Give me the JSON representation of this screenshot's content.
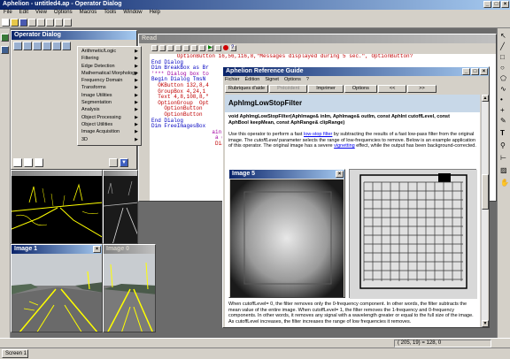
{
  "app": {
    "title": "Aphelion - untitled4.ap - Operator Dialog",
    "menu": [
      "File",
      "Edit",
      "View",
      "Options",
      "Macros",
      "Tools",
      "Window",
      "Help"
    ],
    "status_coords": "( 205,  19) = 128, 0",
    "taskbar_tab": "Screen 1"
  },
  "operator_dialog": {
    "title": "Operator Dialog",
    "categories": [
      "Arithmetic/Logic",
      "Filtering",
      "Edge Detection",
      "Mathematical Morphology",
      "Frequency Domain",
      "Transforms",
      "Image Utilities",
      "Segmentation",
      "Analysis",
      "Object Processing",
      "Object Utilities",
      "Image Acquisition",
      "3D"
    ]
  },
  "code_window": {
    "title": "Read",
    "lines": [
      {
        "t": "        OptionButton 16,56,116,8,\"Messages displayed during 5 sec.\", OptionButton?",
        "c": "c-red"
      },
      {
        "t": "End Dialog",
        "c": "c-blue"
      },
      {
        "t": "Dim BreakBox as Br",
        "c": "c-blue"
      },
      {
        "t": "",
        "c": "c-dark"
      },
      {
        "t": "'*** Dialog box to",
        "c": "c-mag"
      },
      {
        "t": "Begin Dialog TmsN",
        "c": "c-blue"
      },
      {
        "t": "  OKButton 132,8,4",
        "c": "c-red"
      },
      {
        "t": "  GroupBox 4,24,1",
        "c": "c-red"
      },
      {
        "t": "  Text 4,8,108,8,\"",
        "c": "c-red"
      },
      {
        "t": "  OptionGroup  Opt",
        "c": "c-red"
      },
      {
        "t": "    OptionButton",
        "c": "c-red"
      },
      {
        "t": "    OptionButton",
        "c": "c-red"
      },
      {
        "t": "End Dialog",
        "c": "c-blue"
      },
      {
        "t": "Dim FreeImagesBox",
        "c": "c-blue"
      },
      {
        "t": "",
        "c": "c-dark"
      },
      {
        "t": "                   ain pro",
        "c": "c-mag"
      },
      {
        "t": "",
        "c": "c-dark"
      },
      {
        "t": "                    a dial",
        "c": "c-mag"
      },
      {
        "t": "",
        "c": "c-dark"
      },
      {
        "t": "                    Dialo",
        "c": "c-red"
      }
    ]
  },
  "help": {
    "title": "Aphelion Reference Guide",
    "menu": [
      "Fichier",
      "Édition",
      "Signet",
      "Options",
      "?"
    ],
    "buttons": [
      "Rubriques d'aide",
      "Précédent",
      "Imprimer",
      "Options",
      "<<",
      ">>"
    ],
    "heading": "AphImgLowStopFilter",
    "signature_1": "void AphImgLowStopFilter(AphImage& inIm, AphImage& outIm, const AphInt cutoffLevel, const",
    "signature_2": "AphBool keepMean, const AphRange& clipRange)",
    "desc_1": "Use this operator to perform a fast ",
    "desc_link": "low-stop filter",
    "desc_2": " by subtracting the results of a fast low-pass filter from the original image. The ",
    "desc_italic": "cutoffLevel",
    "desc_3": " parameter selects the range of low-frequencies to remove. Below is an example application of this operator. The original image has a severe ",
    "desc_link2": "vignetting",
    "desc_4": " effect, while the output has been background-corrected.",
    "image_window_title": "Image 5",
    "para2": "When cutoffLevel= 0, the filter removes only the 0-frequency component. In other words, the filter subtracts the mean value of the entire image. When cutoffLevel= 1, the filter removes the 1-frequency and 0-frequency components. In other words, it removes any signal with a wavelength greater or equal to the full size of the image. As cutoffLevel increases, the filter increases the range of low frequencies it removes."
  },
  "image_windows": {
    "image1_title": "Image 1",
    "image0_title": "Image 0"
  }
}
